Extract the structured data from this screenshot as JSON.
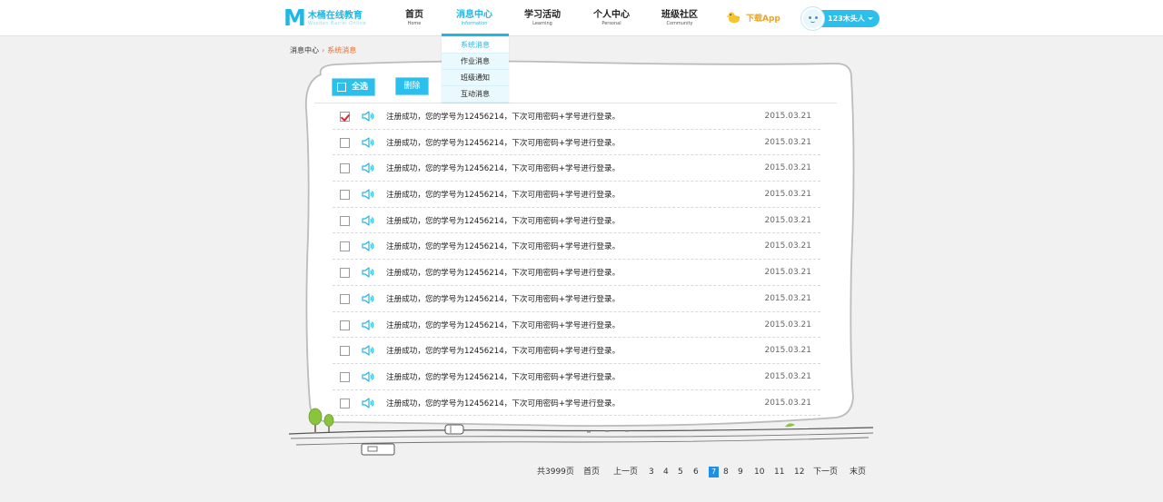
{
  "brand": {
    "name_cn": "木桶在线教育",
    "name_en": "Wooden Barrel Online"
  },
  "nav": [
    {
      "cn": "首页",
      "en": "Home"
    },
    {
      "cn": "消息中心",
      "en": "Information"
    },
    {
      "cn": "学习活动",
      "en": "Learning"
    },
    {
      "cn": "个人中心",
      "en": "Personal"
    },
    {
      "cn": "班级社区",
      "en": "Community"
    }
  ],
  "active_nav": "消息中心",
  "download": {
    "label": "下载App"
  },
  "user": {
    "name": "123木头人"
  },
  "breadcrumb": {
    "home": "消息中心",
    "separator": "›",
    "current": "系统消息"
  },
  "dropdown": [
    "系统消息",
    "作业消息",
    "班级通知",
    "互动消息"
  ],
  "toolbar": {
    "select_all": "全选",
    "delete": "删除"
  },
  "messages": [
    {
      "checked": true,
      "text": "注册成功，您的学号为12456214，下次可用密码+学号进行登录。",
      "date": "2015.03.21"
    },
    {
      "checked": false,
      "text": "注册成功，您的学号为12456214，下次可用密码+学号进行登录。",
      "date": "2015.03.21"
    },
    {
      "checked": false,
      "text": "注册成功，您的学号为12456214，下次可用密码+学号进行登录。",
      "date": "2015.03.21"
    },
    {
      "checked": false,
      "text": "注册成功，您的学号为12456214，下次可用密码+学号进行登录。",
      "date": "2015.03.21"
    },
    {
      "checked": false,
      "text": "注册成功，您的学号为12456214，下次可用密码+学号进行登录。",
      "date": "2015.03.21"
    },
    {
      "checked": false,
      "text": "注册成功，您的学号为12456214，下次可用密码+学号进行登录。",
      "date": "2015.03.21"
    },
    {
      "checked": false,
      "text": "注册成功，您的学号为12456214，下次可用密码+学号进行登录。",
      "date": "2015.03.21"
    },
    {
      "checked": false,
      "text": "注册成功，您的学号为12456214，下次可用密码+学号进行登录。",
      "date": "2015.03.21"
    },
    {
      "checked": false,
      "text": "注册成功，您的学号为12456214，下次可用密码+学号进行登录。",
      "date": "2015.03.21"
    },
    {
      "checked": false,
      "text": "注册成功，您的学号为12456214，下次可用密码+学号进行登录。",
      "date": "2015.03.21"
    },
    {
      "checked": false,
      "text": "注册成功，您的学号为12456214，下次可用密码+学号进行登录。",
      "date": "2015.03.21"
    },
    {
      "checked": false,
      "text": "注册成功，您的学号为12456214，下次可用密码+学号进行登录。",
      "date": "2015.03.21"
    }
  ],
  "pagination": {
    "total": "共3999页",
    "first": "首页",
    "prev": "上一页",
    "pages": [
      "3",
      "4",
      "5",
      "6",
      "7",
      "8",
      "9",
      "10",
      "11",
      "12"
    ],
    "current": "7",
    "next": "下一页",
    "last": "末页"
  },
  "colors": {
    "accent": "#1fb8e6",
    "highlight": "#f06a2b",
    "download": "#f2a31d",
    "check": "#e2282e",
    "current_page": "#1f8fe6"
  },
  "icons": {
    "speaker": "speaker-icon",
    "download": "duck-icon"
  }
}
